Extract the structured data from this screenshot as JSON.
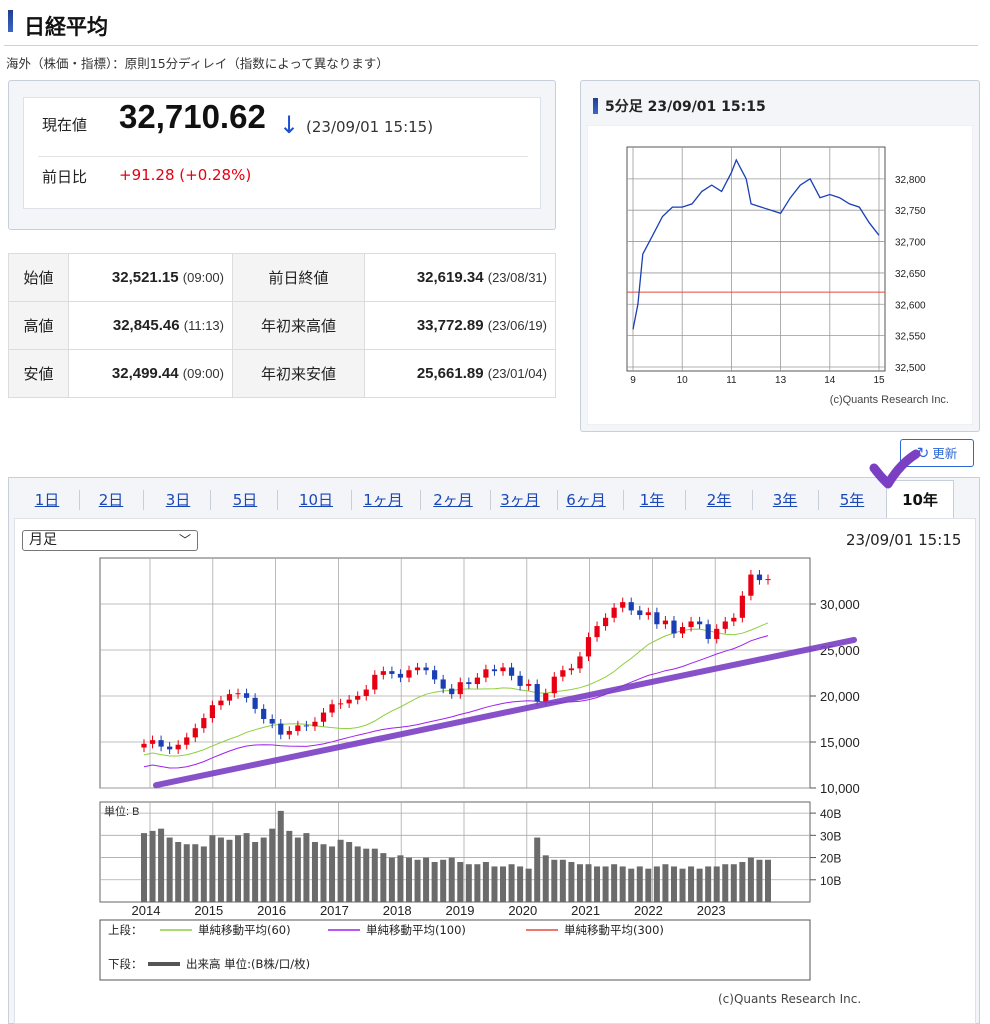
{
  "header": {
    "title": "日経平均",
    "notice": "海外（株価・指標）：原則15分ディレイ（指数によって異なります）"
  },
  "current": {
    "label": "現在値",
    "value": "32,710.62",
    "arrow": "↓",
    "time": "(23/09/01 15:15)",
    "change_label": "前日比",
    "change": "+91.28 (+0.28%)"
  },
  "stats": {
    "rows": [
      {
        "l1": "始値",
        "v1": "32,521.15",
        "t1": "(09:00)",
        "l2": "前日終値",
        "v2": "32,619.34",
        "t2": "(23/08/31)"
      },
      {
        "l1": "高値",
        "v1": "32,845.46",
        "t1": "(11:13)",
        "l2": "年初来高値",
        "v2": "33,772.89",
        "t2": "(23/06/19)"
      },
      {
        "l1": "安値",
        "v1": "32,499.44",
        "t1": "(09:00)",
        "l2": "年初来安値",
        "v2": "25,661.89",
        "t2": "(23/01/04)"
      }
    ]
  },
  "intraday": {
    "title": "5分足 23/09/01 15:15",
    "credit": "(c)Quants Research Inc."
  },
  "refresh_label": "更新",
  "tabs": [
    "1日",
    "2日",
    "3日",
    "5日",
    "10日",
    "1ヶ月",
    "2ヶ月",
    "3ヶ月",
    "6ヶ月",
    "1年",
    "2年",
    "3年",
    "5年",
    "10年"
  ],
  "active_tab": "10年",
  "period_select": "月足",
  "main_time": "23/09/01 15:15",
  "legend": {
    "upper_label": "上段：",
    "ma60": "単純移動平均(60)",
    "ma100": "単純移動平均(100)",
    "ma300": "単純移動平均(300)",
    "lower_label": "下段：",
    "volume": "出来高 単位:(B株/口/枚)"
  },
  "main_credit": "(c)Quants Research Inc.",
  "colors": {
    "up": "#e60012",
    "down": "#1a3fb5",
    "ma60": "#8fcf3c",
    "ma100": "#a020f0",
    "ma300": "#e8493b",
    "trend": "#7b3fc4"
  },
  "chart_data": [
    {
      "type": "line",
      "title": "5分足 23/09/01 15:15",
      "x_ticks": [
        "9",
        "10",
        "11",
        "13",
        "14",
        "15"
      ],
      "y_ticks": [
        "32,500",
        "32,550",
        "32,600",
        "32,650",
        "32,700",
        "32,750",
        "32,800"
      ],
      "ylim": [
        32500,
        32800
      ],
      "reference_line": 32619.34,
      "series": [
        {
          "x": [
            9.0,
            9.1,
            9.2,
            9.4,
            9.6,
            9.8,
            10.0,
            10.2,
            10.4,
            10.6,
            10.8,
            11.0,
            11.2,
            11.4,
            11.6,
            11.8,
            13.0,
            13.2,
            13.4,
            13.6,
            13.8,
            14.0,
            14.2,
            14.4,
            14.6,
            14.8,
            15.0
          ],
          "y": [
            32560,
            32600,
            32680,
            32710,
            32740,
            32755,
            32755,
            32760,
            32780,
            32790,
            32780,
            32810,
            32830,
            32815,
            32800,
            32760,
            32745,
            32770,
            32790,
            32800,
            32770,
            32775,
            32770,
            32760,
            32755,
            32730,
            32710
          ]
        }
      ]
    },
    {
      "type": "candlestick",
      "title": "",
      "categories": [
        "2014",
        "2015",
        "2016",
        "2017",
        "2018",
        "2019",
        "2020",
        "2021",
        "2022",
        "2023"
      ],
      "y_ticks": [
        "10,000",
        "15,000",
        "20,000",
        "25,000",
        "30,000"
      ],
      "ylim": [
        10000,
        35000
      ],
      "volume_ticks": [
        "10B",
        "20B",
        "30B",
        "40B"
      ],
      "volume_unit": "単位: B",
      "close_series": [
        14800,
        15200,
        14500,
        14200,
        14700,
        15500,
        16500,
        17600,
        19000,
        19500,
        20200,
        20300,
        19800,
        18600,
        17500,
        17000,
        15800,
        16200,
        16800,
        16700,
        17200,
        18200,
        19100,
        19200,
        19600,
        20000,
        20700,
        22300,
        22700,
        22400,
        22000,
        22800,
        23100,
        22800,
        21800,
        20800,
        20200,
        21500,
        21300,
        22000,
        22900,
        22700,
        23100,
        22200,
        21100,
        21300,
        19400,
        20300,
        22100,
        22800,
        23000,
        24300,
        26400,
        27600,
        28500,
        29600,
        30200,
        29300,
        28800,
        29100,
        27800,
        28200,
        26800,
        27500,
        28100,
        27800,
        26200,
        27300,
        28100,
        28500,
        30900,
        33200,
        32600,
        32710
      ],
      "volume_series": [
        31,
        32,
        33,
        29,
        27,
        26,
        26,
        25,
        30,
        29,
        28,
        30,
        31,
        27,
        29,
        33,
        41,
        32,
        29,
        31,
        27,
        26,
        25,
        28,
        27,
        25,
        24,
        24,
        22,
        20,
        21,
        20,
        19,
        20,
        18,
        19,
        20,
        18,
        17,
        17,
        18,
        16,
        16,
        17,
        16,
        15,
        29,
        21,
        19,
        19,
        18,
        17,
        17,
        16,
        16,
        17,
        16,
        15,
        16,
        15,
        16,
        17,
        16,
        15,
        16,
        15,
        16,
        16,
        17,
        17,
        18,
        20,
        19,
        19
      ]
    }
  ]
}
